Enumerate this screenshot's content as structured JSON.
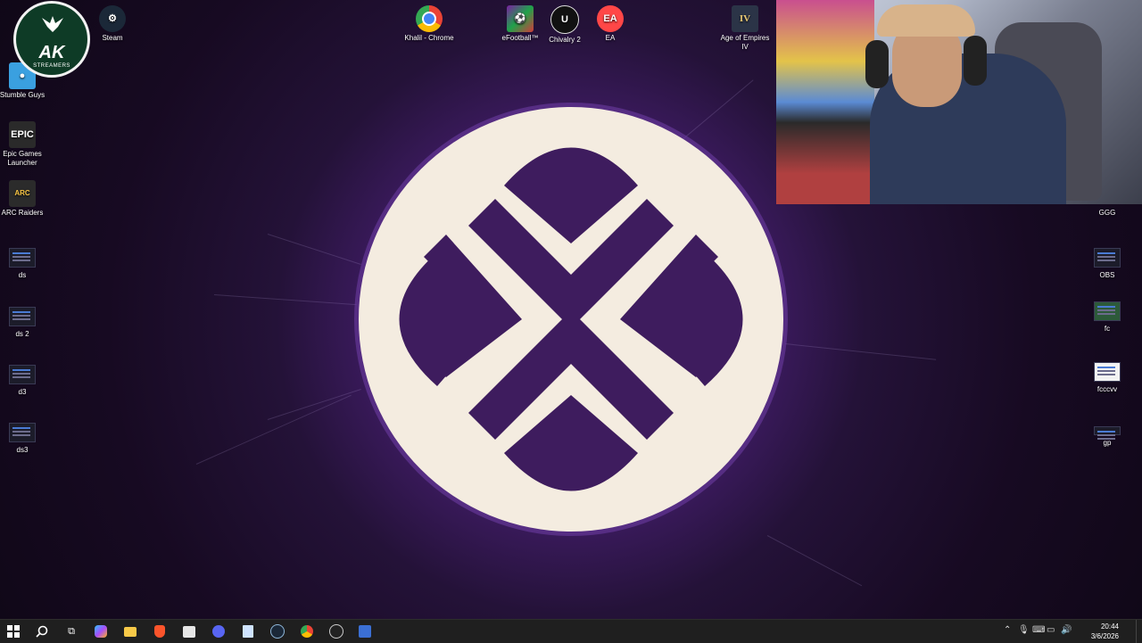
{
  "desktop": {
    "left_icons": [
      {
        "label": "Stumble Guys",
        "icon": "stumble-guys-icon",
        "color": "#3aa0e0"
      },
      {
        "label": "Epic Games Launcher",
        "icon": "epic-games-icon",
        "color": "#2a2a2a"
      },
      {
        "label": "ARC Raiders",
        "icon": "arc-raiders-icon",
        "color": "#2b2b2b"
      },
      {
        "label": "ds",
        "icon": "screenshot-file-icon"
      },
      {
        "label": "ds 2",
        "icon": "screenshot-file-icon"
      },
      {
        "label": "d3",
        "icon": "screenshot-file-icon"
      },
      {
        "label": "ds3",
        "icon": "screenshot-file-icon"
      }
    ],
    "top_icons": [
      {
        "label": "Steam",
        "icon": "steam-icon",
        "color": "#1b2838"
      },
      {
        "label": "Khalil - Chrome",
        "icon": "chrome-icon",
        "color": "#ffffff"
      },
      {
        "label": "eFootball™",
        "icon": "efootball-icon",
        "color": "#7a1fa2"
      },
      {
        "label": "Chivalry 2",
        "icon": "unreal-icon",
        "color": "#111111"
      },
      {
        "label": "EA",
        "icon": "ea-icon",
        "color": "#ff4747"
      },
      {
        "label": "Age of Empires IV",
        "icon": "age-of-empires-icon",
        "color": "#2b3447"
      }
    ],
    "right_icons": [
      {
        "label": "GGG",
        "icon": "file-icon"
      },
      {
        "label": "OBS",
        "icon": "screenshot-file-icon"
      },
      {
        "label": "fc",
        "icon": "screenshot-file-icon"
      },
      {
        "label": "fcccvv",
        "icon": "document-icon"
      },
      {
        "label": "gp",
        "icon": "file-icon"
      }
    ],
    "overlay_logo": {
      "title": "AK",
      "subtitle": "STREAMERS"
    },
    "emblem_colors": {
      "ring": "#f4ece0",
      "shape": "#3e1c5e"
    }
  },
  "taskbar": {
    "apps": [
      "start-icon",
      "search-icon",
      "task-view-icon",
      "copilot-icon",
      "file-explorer-icon",
      "brave-icon",
      "store-icon",
      "discord-icon",
      "notepad-icon",
      "steam-icon",
      "chrome-icon",
      "obs-icon",
      "app-icon"
    ],
    "clock_time": "20:44",
    "clock_date": "3/6/2026"
  }
}
